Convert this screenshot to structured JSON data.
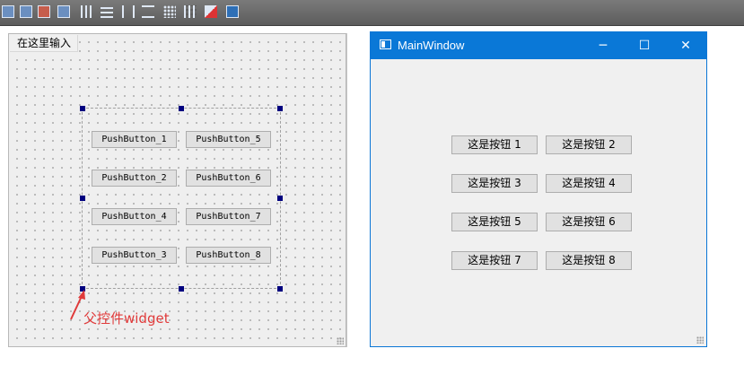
{
  "toolbar": {
    "icons": [
      "widget-icon",
      "layout-icon",
      "break-icon",
      "buddy-icon",
      "horizontal-layout-icon",
      "vertical-layout-icon",
      "h-splitter-icon",
      "v-splitter-icon",
      "form-layout-icon",
      "grid-layout-icon",
      "break-layout-icon",
      "adjust-size-icon"
    ]
  },
  "designer": {
    "menu_placeholder": "在这里输入",
    "buttons": [
      "PushButton_1",
      "PushButton_5",
      "PushButton_2",
      "PushButton_6",
      "PushButton_4",
      "PushButton_7",
      "PushButton_3",
      "PushButton_8"
    ],
    "annotation": "父控件widget",
    "annotation_color": "#e03a3a"
  },
  "window": {
    "title": "MainWindow",
    "controls": {
      "minimize": "─",
      "maximize": "☐",
      "close": "✕"
    },
    "titlebar_color": "#0a78d7",
    "buttons": [
      "这是按钮 1",
      "这是按钮 2",
      "这是按钮 3",
      "这是按钮 4",
      "这是按钮 5",
      "这是按钮 6",
      "这是按钮 7",
      "这是按钮 8"
    ]
  }
}
